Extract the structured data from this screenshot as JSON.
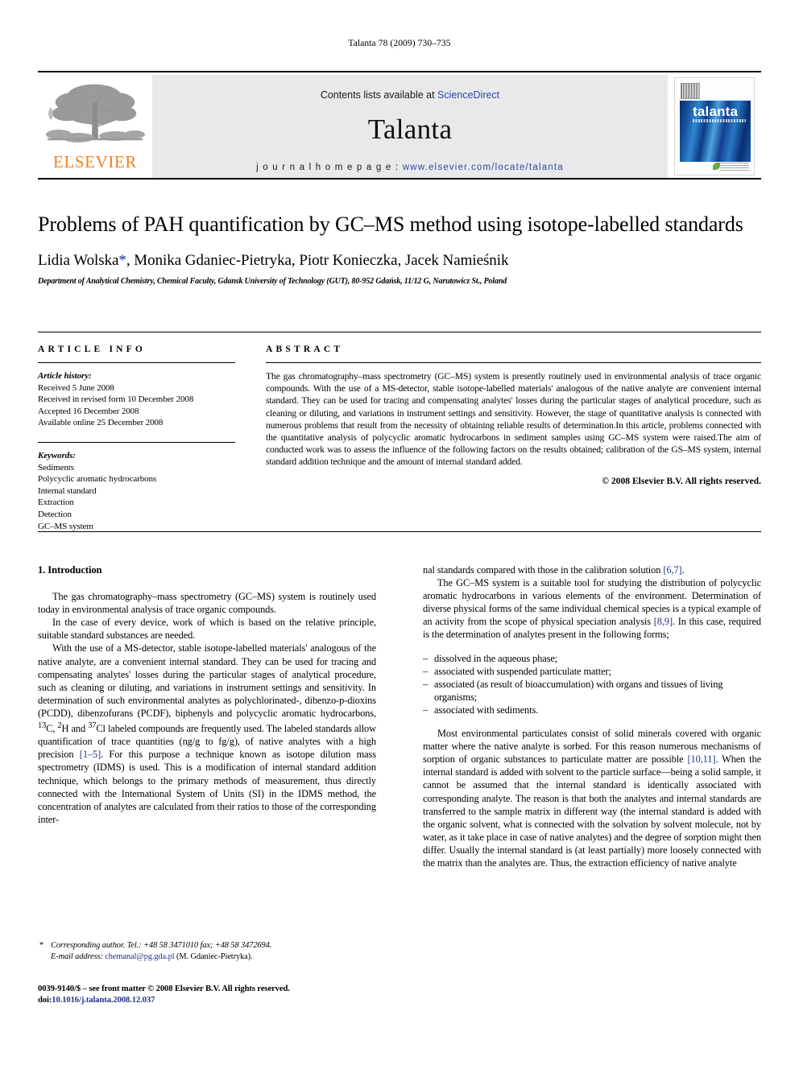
{
  "running_head": "Talanta 78 (2009) 730–735",
  "masthead": {
    "publisher_logo_text": "ELSEVIER",
    "contents_prefix": "Contents lists available at ",
    "contents_link": "ScienceDirect",
    "journal_title": "Talanta",
    "homepage_prefix": "j o u r n a l   h o m e p a g e :  ",
    "homepage_url": "www.elsevier.com/locate/talanta",
    "cover_word": "talanta"
  },
  "article": {
    "title": "Problems of PAH quantification by GC–MS method using isotope-labelled standards",
    "authors": "Lidia Wolska",
    "authors_star": "*",
    "authors_rest": ", Monika Gdaniec-Pietryka, Piotr Konieczka, Jacek Namieśnik",
    "affiliation": "Department of Analytical Chemistry, Chemical Faculty, Gdansk University of Technology (GUT), 80-952 Gdańsk, 11/12 G, Narutowicz St., Poland"
  },
  "info": {
    "heading": "ARTICLE INFO",
    "history_label": "Article history:",
    "history": [
      "Received 5 June 2008",
      "Received in revised form 10 December 2008",
      "Accepted 16 December 2008",
      "Available online 25 December 2008"
    ],
    "keywords_label": "Keywords:",
    "keywords": [
      "Sediments",
      "Polycyclic aromatic hydrocarbons",
      "Internal standard",
      "Extraction",
      "Detection",
      "GC–MS system"
    ]
  },
  "abstract": {
    "heading": "ABSTRACT",
    "text": "The gas chromatography–mass spectrometry (GC–MS) system is presently routinely used in environmental analysis of trace organic compounds. With the use of a MS-detector, stable isotope-labelled materials' analogous of the native analyte are convenient internal standard. They can be used for tracing and compensating analytes' losses during the particular stages of analytical procedure, such as cleaning or diluting, and variations in instrument settings and sensitivity. However, the stage of quantitative analysis is connected with numerous problems that result from the necessity of obtaining reliable results of determination.In this article, problems connected with the quantitative analysis of polycyclic aromatic hydrocarbons in sediment samples using GC–MS system were raised.The aim of conducted work was to assess the influence of the following factors on the results obtained; calibration of the GS–MS system, internal standard addition technique and the amount of internal standard added.",
    "copyright": "© 2008 Elsevier B.V. All rights reserved."
  },
  "body": {
    "section_heading": "1. Introduction",
    "left_paragraphs": [
      "The gas chromatography–mass spectrometry (GC–MS) system is routinely used today in environmental analysis of trace organic compounds.",
      "In the case of every device, work of which is based on the relative principle, suitable standard substances are needed."
    ],
    "left_para3_a": "With the use of a MS-detector, stable isotope-labelled materials' analogous of the native analyte, are a convenient internal standard. They can be used for tracing and compensating analytes' losses during the particular stages of analytical procedure, such as cleaning or diluting, and variations in instrument settings and sensitivity. In determination of such environmental analytes as polychlorinated-, dibenzo-p-dioxins (PCDD), dibenzofurans (PCDF), biphenyls and polycyclic aromatic hydrocarbons, ",
    "left_para3_iso1": "13",
    "left_para3_iso1b": "C, ",
    "left_para3_iso2": "2",
    "left_para3_iso2b": "H and ",
    "left_para3_iso3": "37",
    "left_para3_iso3b": "Cl labeled compounds are frequently used. The labeled standards allow quantification of trace quantities (ng/g to fg/g), of native analytes with a high precision ",
    "left_para3_ref": "[1–5]",
    "left_para3_b": ". For this purpose a technique known as isotope dilution mass spectrometry (IDMS) is used. This is a modification of internal standard addition technique, which belongs to the primary methods of measurement, thus directly connected with the International System of Units (SI) in the IDMS method, the concentration of analytes are calculated from their ratios to those of the corresponding inter-",
    "right_para1_a": "nal standards compared with those in the calibration solution ",
    "right_para1_ref": "[6,7]",
    "right_para1_b": ".",
    "right_para2_a": "The GC–MS system is a suitable tool for studying the distribution of polycyclic aromatic hydrocarbons in various elements of the environment. Determination of diverse physical forms of the same individual chemical species is a typical example of an activity from the scope of physical speciation analysis ",
    "right_para2_ref": "[8,9]",
    "right_para2_b": ". In this case, required is the determination of analytes present in the following forms;",
    "list_items": [
      "dissolved in the aqueous phase;",
      "associated with suspended particulate matter;",
      "associated (as result of bioaccumulation) with organs and tissues of living organisms;",
      "associated with sediments."
    ],
    "right_para3_a": "Most environmental particulates consist of solid minerals covered with organic matter where the native analyte is sorbed. For this reason numerous mechanisms of sorption of organic substances to particulate matter are possible ",
    "right_para3_ref": "[10,11]",
    "right_para3_b": ". When the internal standard is added with solvent to the particle surface—being a solid sample, it cannot be assumed that the internal standard is identically associated with corresponding analyte. The reason is that both the analytes and internal standards are transferred to the sample matrix in different way (the internal standard is added with the organic solvent, what is connected with the solvation by solvent molecule, not by water, as it take place in case of native analytes) and the degree of sorption might then differ. Usually the internal standard is (at least partially) more loosely connected with the matrix than the analytes are. Thus, the extraction efficiency of native analyte"
  },
  "footnotes": {
    "star": "*",
    "corresponding": "Corresponding author. Tel.: +48 58 3471010 fax; +48 58 3472694.",
    "email_label": "E-mail address:",
    "email": "chemanal@pg.gda.pl",
    "email_suffix": " (M. Gdaniec-Pietryka).",
    "imprint": "0039-9140/$ – see front matter © 2008 Elsevier B.V. All rights reserved.",
    "doi_label": "doi:",
    "doi": "10.1016/j.talanta.2008.12.037"
  }
}
